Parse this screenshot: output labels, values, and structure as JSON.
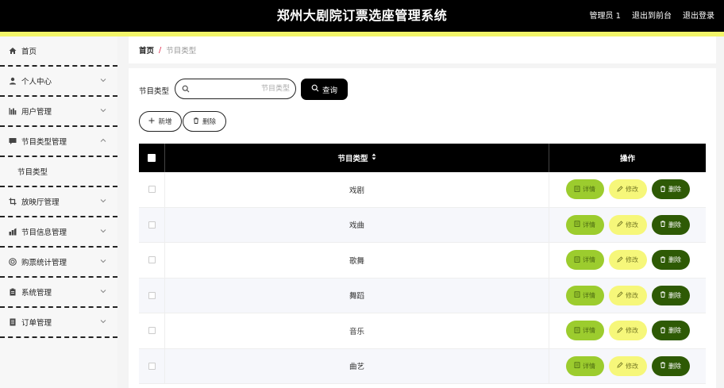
{
  "header": {
    "title": "郑州大剧院订票选座管理系统",
    "user": "管理员 1",
    "back_front": "退出到前台",
    "logout": "退出登录"
  },
  "sidebar": {
    "items": [
      {
        "label": "首页",
        "icon": "home-icon",
        "has_arrow": false
      },
      {
        "label": "个人中心",
        "icon": "user-icon",
        "has_arrow": true
      },
      {
        "label": "用户管理",
        "icon": "bar-chart-icon",
        "has_arrow": true
      },
      {
        "label": "节目类型管理",
        "icon": "comment-icon",
        "has_arrow": true,
        "expanded": true,
        "children": [
          "节目类型"
        ]
      },
      {
        "label": "放映厅管理",
        "icon": "crop-icon",
        "has_arrow": true
      },
      {
        "label": "节目信息管理",
        "icon": "stats-icon",
        "has_arrow": true
      },
      {
        "label": "购票统计管理",
        "icon": "help-circle-icon",
        "has_arrow": true
      },
      {
        "label": "系统管理",
        "icon": "clipboard-icon",
        "has_arrow": true
      },
      {
        "label": "订单管理",
        "icon": "document-icon",
        "has_arrow": true
      }
    ]
  },
  "breadcrumb": {
    "home": "首页",
    "separator": "/",
    "current": "节目类型"
  },
  "search": {
    "label": "节目类型",
    "placeholder": "节目类型",
    "button": "查询"
  },
  "actions": {
    "add": "新增",
    "delete": "删除"
  },
  "table": {
    "columns": [
      "节目类型",
      "操作"
    ],
    "rows": [
      "戏剧",
      "戏曲",
      "歌舞",
      "舞蹈",
      "音乐",
      "曲艺"
    ],
    "ops": {
      "detail": "详情",
      "edit": "修改",
      "delete": "删除"
    }
  },
  "colors": {
    "header_bg": "#000000",
    "accent": "#f2f56a",
    "detail_btn": "#9ccc2e",
    "edit_btn": "#f6f77a",
    "delete_btn": "#2e5a05"
  }
}
